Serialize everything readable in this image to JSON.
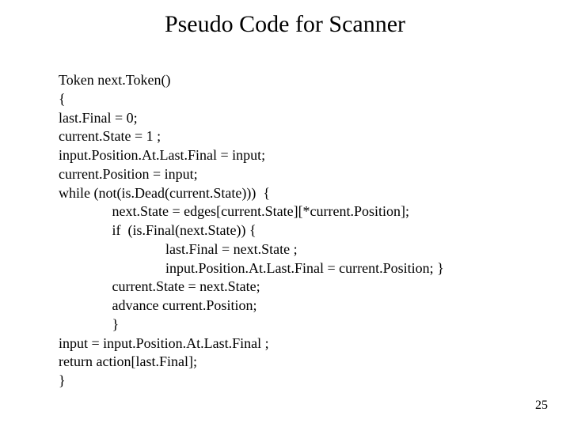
{
  "title": "Pseudo Code for Scanner",
  "code": {
    "l1": "Token next.Token()",
    "l2": "{",
    "l3": "last.Final = 0;",
    "l4": "current.State = 1 ;",
    "l5": "input.Position.At.Last.Final = input;",
    "l6": "current.Position = input;",
    "l7": "while (not(is.Dead(current.State)))  {",
    "l8": "               next.State = edges[current.State][*current.Position];",
    "l9": "               if  (is.Final(next.State)) {",
    "l10": "                              last.Final = next.State ;",
    "l11": "                              input.Position.At.Last.Final = current.Position; }",
    "l12": "               current.State = next.State;",
    "l13": "               advance current.Position;",
    "l14": "               }",
    "l15": "input = input.Position.At.Last.Final ;",
    "l16": "return action[last.Final];",
    "l17": "}"
  },
  "page_number": "25"
}
